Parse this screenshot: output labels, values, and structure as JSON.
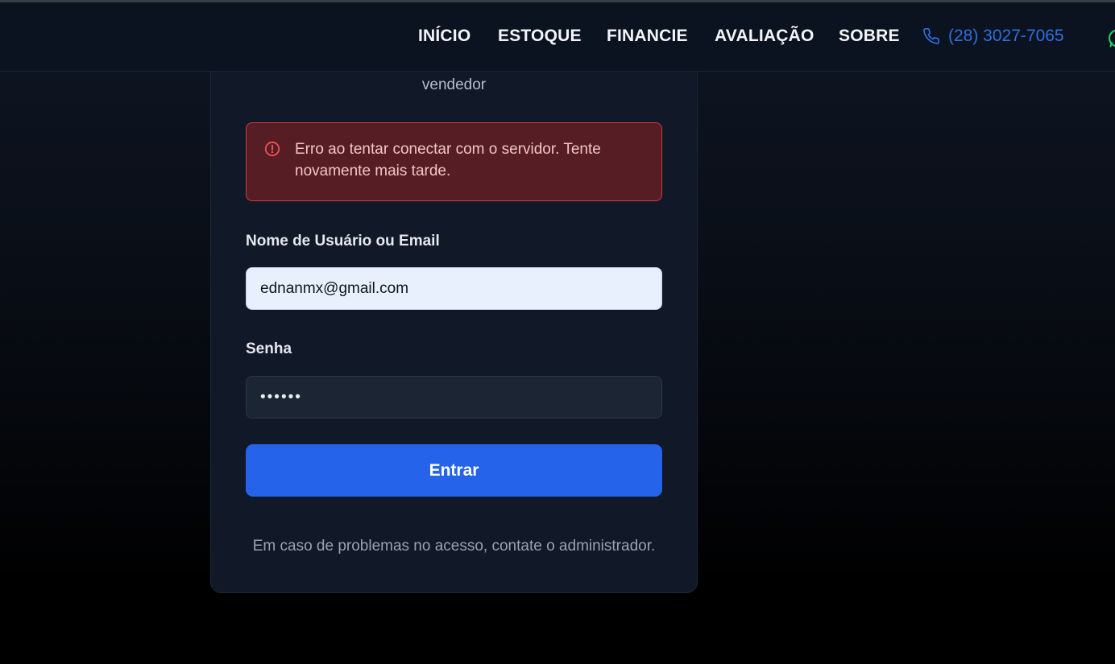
{
  "nav": {
    "items": [
      {
        "label": "INÍCIO"
      },
      {
        "label": "ESTOQUE"
      },
      {
        "label": "FINANCIE"
      },
      {
        "label": "AVALIAÇÃO"
      },
      {
        "label": "SOBRE"
      }
    ],
    "phone": "(28) 3027-7065",
    "phone_icon": "phone-icon",
    "whatsapp_icon": "whatsapp-icon"
  },
  "login": {
    "subtitle": "vendedor",
    "error": {
      "icon": "alert-circle-icon",
      "message": "Erro ao tentar conectar com o servidor. Tente novamente mais tarde."
    },
    "username": {
      "label": "Nome de Usuário ou Email",
      "value": "ednanmx@gmail.com"
    },
    "password": {
      "label": "Senha",
      "value": "••••••"
    },
    "submit_label": "Entrar",
    "footer_note": "Em caso de problemas no acesso, contate o administrador."
  },
  "colors": {
    "accent": "#2563eb",
    "error_border": "#d03a40",
    "error_bg": "#561e24",
    "phone_link": "#2f6fde",
    "whatsapp": "#25d366"
  }
}
